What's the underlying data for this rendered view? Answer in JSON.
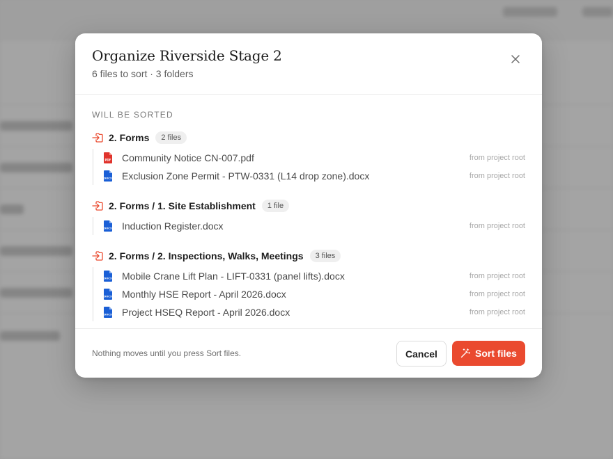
{
  "modal": {
    "title": "Organize Riverside Stage 2",
    "subtitle": "6 files to sort · 3 folders",
    "close_icon": "close-icon",
    "section_label": "WILL BE SORTED",
    "groups": [
      {
        "name": "2. Forms",
        "badge": "2 files",
        "files": [
          {
            "name": "Community Notice CN-007.pdf",
            "type": "pdf",
            "from": "from project root"
          },
          {
            "name": "Exclusion Zone Permit - PTW-0331 (L14 drop zone).docx",
            "type": "docx",
            "from": "from project root"
          }
        ]
      },
      {
        "name": "2. Forms / 1. Site Establishment",
        "badge": "1 file",
        "files": [
          {
            "name": "Induction Register.docx",
            "type": "docx",
            "from": "from project root"
          }
        ]
      },
      {
        "name": "2. Forms / 2. Inspections, Walks, Meetings",
        "badge": "3 files",
        "files": [
          {
            "name": "Mobile Crane Lift Plan - LIFT-0331 (panel lifts).docx",
            "type": "docx",
            "from": "from project root"
          },
          {
            "name": "Monthly HSE Report - April 2026.docx",
            "type": "docx",
            "from": "from project root"
          },
          {
            "name": "Project HSEQ Report - April 2026.docx",
            "type": "docx",
            "from": "from project root"
          }
        ]
      }
    ],
    "footer_note": "Nothing moves until you press Sort files.",
    "cancel_label": "Cancel",
    "sort_label": "Sort files"
  },
  "colors": {
    "accent": "#ea4a2f",
    "pdf": "#e0332c",
    "docx": "#1a5fd6",
    "backdrop": "#a9a9a9"
  },
  "icons": {
    "folder": "folder-move-icon",
    "pdf": "pdf-file-icon",
    "docx": "docx-file-icon",
    "sort": "magic-wand-icon"
  }
}
